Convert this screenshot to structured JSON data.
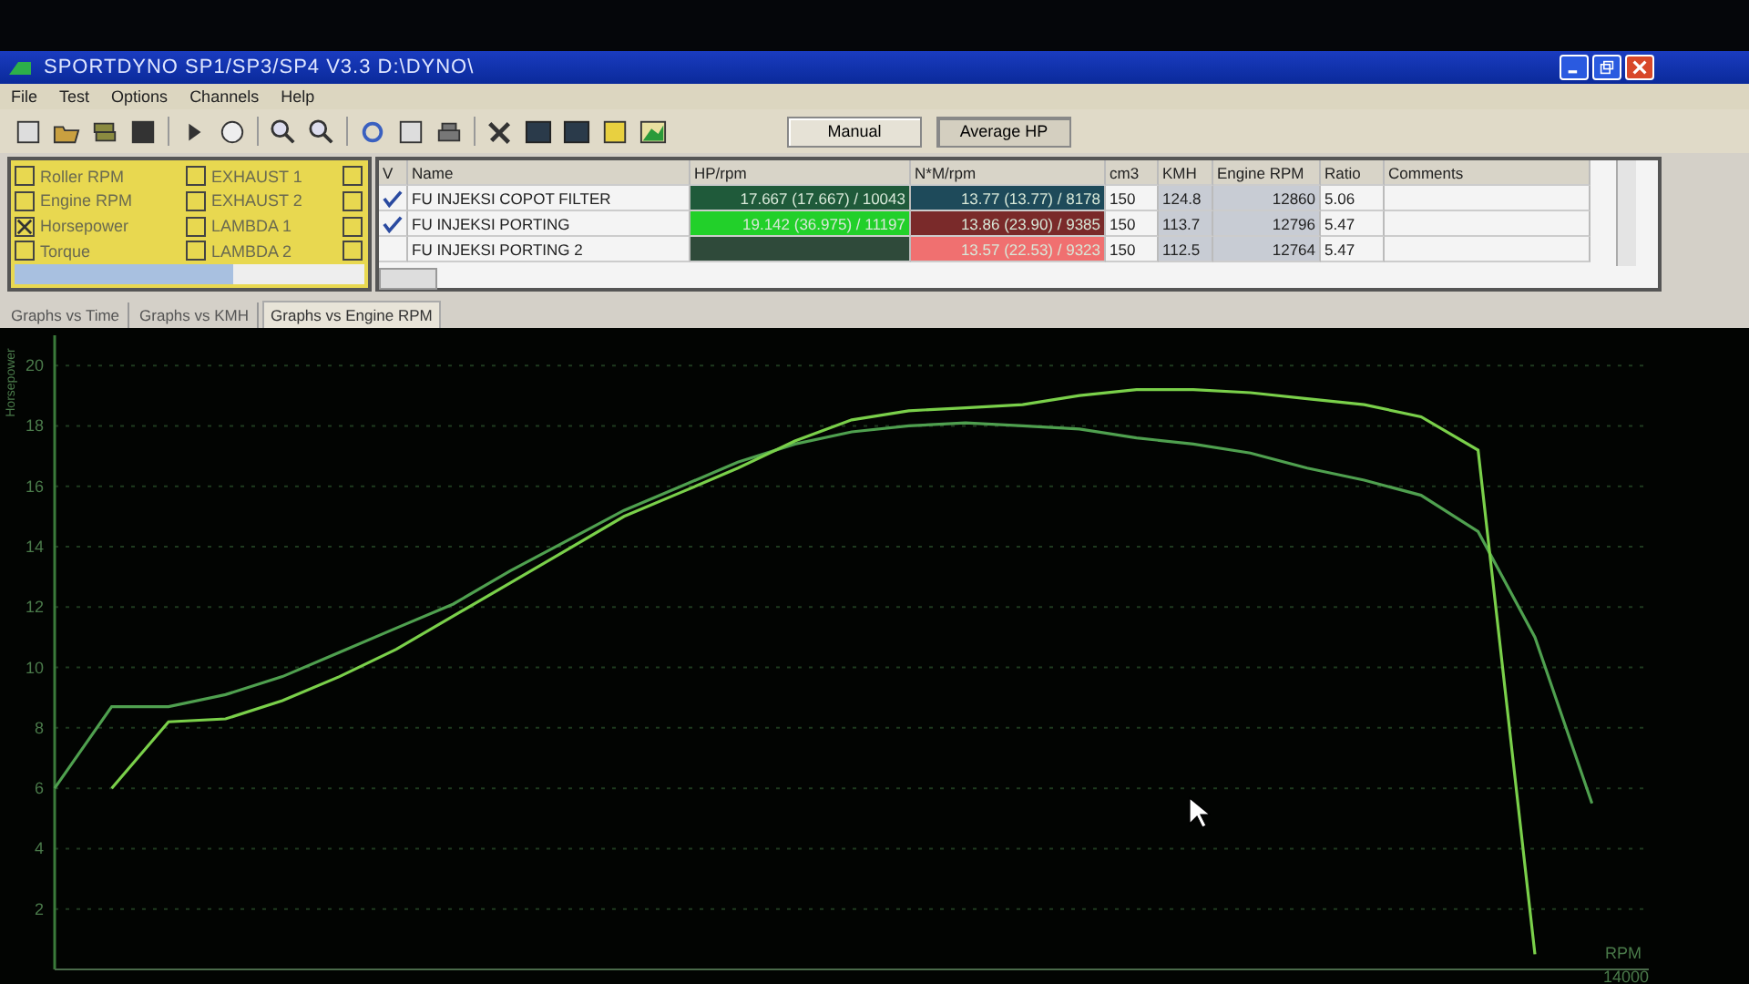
{
  "window": {
    "title": "SPORTDYNO SP1/SP3/SP4  V3.3  D:\\DYNO\\"
  },
  "menu": [
    "File",
    "Test",
    "Options",
    "Channels",
    "Help"
  ],
  "toolbar_buttons": [
    {
      "label": "Manual",
      "selected": false
    },
    {
      "label": "Average HP",
      "selected": true
    }
  ],
  "channels": [
    {
      "label": "Roller RPM",
      "checked": false
    },
    {
      "label": "EXHAUST 1",
      "checked": false
    },
    {
      "checked": false
    },
    {
      "label": "Engine RPM",
      "checked": false
    },
    {
      "label": "EXHAUST 2",
      "checked": false
    },
    {
      "checked": false
    },
    {
      "label": "Horsepower",
      "checked": true
    },
    {
      "label": "LAMBDA 1",
      "checked": false
    },
    {
      "checked": false
    },
    {
      "label": "Torque",
      "checked": false
    },
    {
      "label": "LAMBDA 2",
      "checked": false
    },
    {
      "checked": false
    }
  ],
  "table": {
    "columns": [
      "V",
      "Name",
      "HP/rpm",
      "N*M/rpm",
      "cm3",
      "KMH",
      "Engine RPM",
      "Ratio",
      "Comments"
    ],
    "rows": [
      {
        "checked": true,
        "name": "FU INJEKSI COPOT FILTER",
        "hp": {
          "value": "17.667 (17.667) / 10043",
          "color": "#1f5a3a"
        },
        "nm": {
          "value": "13.77 (13.77) / 8178",
          "color": "#1e4a5a"
        },
        "cm3": "150",
        "kmh": "124.8",
        "engine_rpm": "12860",
        "ratio": "5.06"
      },
      {
        "checked": true,
        "name": "FU INJEKSI PORTING",
        "hp": {
          "value": "19.142 (36.975) / 11197",
          "color": "#22d02a"
        },
        "nm": {
          "value": "13.86 (23.90) / 9385",
          "color": "#7a2a2a"
        },
        "cm3": "150",
        "kmh": "113.7",
        "engine_rpm": "12796",
        "ratio": "5.47"
      },
      {
        "checked": false,
        "name": "FU INJEKSI PORTING 2",
        "hp": {
          "color": "#2f4a3a"
        },
        "nm": {
          "value": "13.57 (22.53) / 9323",
          "color": "#f07070"
        },
        "cm3": "150",
        "kmh": "112.5",
        "engine_rpm": "12764",
        "ratio": "5.47"
      }
    ]
  },
  "tabs": [
    {
      "label": "Graphs vs Time",
      "selected": false
    },
    {
      "label": "Graphs vs KMH",
      "selected": false
    },
    {
      "label": "Graphs vs Engine RPM",
      "selected": true
    }
  ],
  "chart_data": {
    "type": "line",
    "xlabel": "RPM",
    "ylabel": "Horsepower",
    "series": [
      {
        "color": "#4fa04f",
        "values": [
          6.0,
          8.7,
          8.7,
          9.1,
          9.7,
          10.5,
          11.3,
          12.1,
          13.2,
          14.2,
          15.2,
          16.0,
          16.8,
          17.4,
          17.8,
          18.0,
          18.1,
          18.0,
          17.9,
          17.6,
          17.4,
          17.1,
          16.6,
          16.2,
          15.7,
          14.5,
          11.0,
          5.5
        ]
      },
      {
        "color": "#7ad04a",
        "values": [
          null,
          6.0,
          8.2,
          8.3,
          8.9,
          9.7,
          10.6,
          11.7,
          12.8,
          13.9,
          15.0,
          15.8,
          16.6,
          17.5,
          18.2,
          18.5,
          18.6,
          18.7,
          19.0,
          19.2,
          19.2,
          19.1,
          18.9,
          18.7,
          18.3,
          17.2,
          0.5,
          null
        ]
      }
    ],
    "ylim": [
      0,
      21
    ],
    "yticks": [
      2,
      4,
      6,
      8,
      10,
      12,
      14,
      16,
      18,
      20
    ],
    "grid": true,
    "annotations": [
      {
        "text": "14000"
      }
    ]
  }
}
